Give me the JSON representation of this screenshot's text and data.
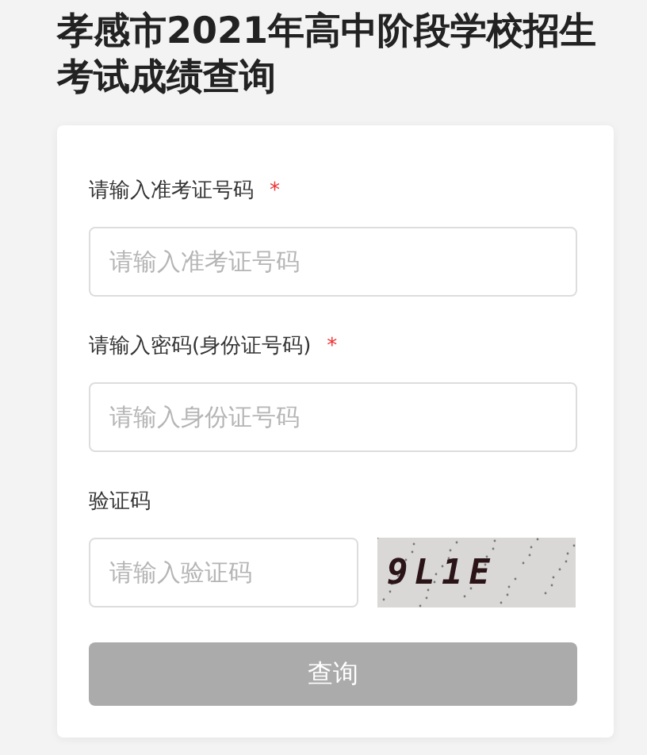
{
  "title": "孝感市2021年高中阶段学校招生考试成绩查询",
  "fields": [
    {
      "kind": "text",
      "label": "请输入准考证号码",
      "required_mark": "*",
      "placeholder": "请输入准考证号码"
    },
    {
      "kind": "text",
      "label": "请输入密码(身份证号码)",
      "required_mark": "*",
      "placeholder": "请输入身份证号码"
    },
    {
      "kind": "captcha",
      "label": "验证码",
      "placeholder": "请输入验证码",
      "captcha": "9L1E"
    }
  ],
  "submit": {
    "label": "查询",
    "disabled": true
  }
}
